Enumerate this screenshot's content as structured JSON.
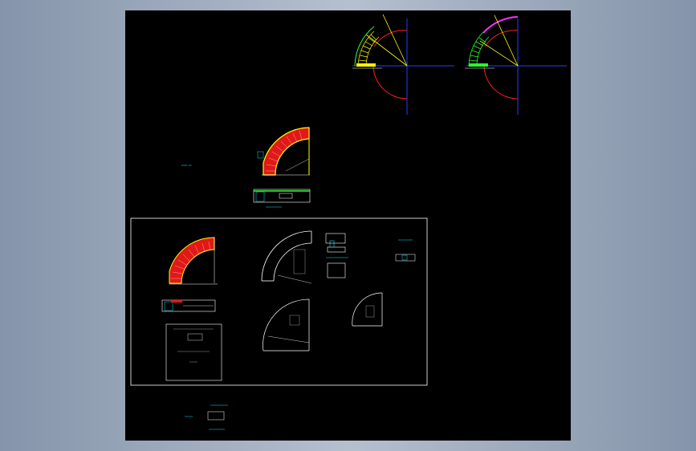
{
  "page": {
    "background_color": "#8594aa",
    "canvas_color": "#000000"
  },
  "colors": {
    "frame": "#ffffff",
    "axis": "#2040ff",
    "arc": "#ff1e1e",
    "yellow": "#ffff00",
    "green": "#2cff2c",
    "magenta": "#ff30ff",
    "cyan": "#00e5ff",
    "red_fill": "#e01818",
    "white": "#ffffff"
  },
  "drawings": {
    "conveyor_plan_yellow": {
      "icon": "curved-roller-conveyor-plan"
    },
    "conveyor_plan_green": {
      "icon": "curved-roller-conveyor-plan"
    },
    "section_main": {
      "icon": "curved-conveyor-section"
    },
    "frame_group": {
      "icon": "drawing-border"
    }
  }
}
